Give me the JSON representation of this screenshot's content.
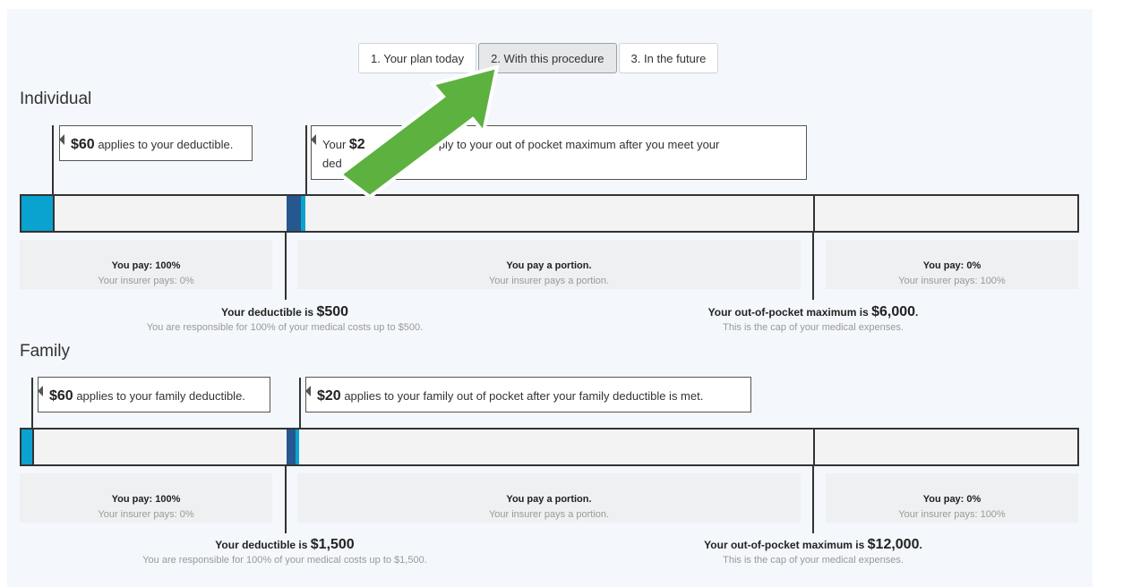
{
  "tabs": [
    {
      "label": "1. Your plan today"
    },
    {
      "label": "2. With this procedure",
      "active": true
    },
    {
      "label": "3. In the future"
    }
  ],
  "colors": {
    "accent_teal": "#0aa2cf",
    "accent_navy": "#26588f",
    "arrow_green": "#5cb13f"
  },
  "individual": {
    "title": "Individual",
    "callout_deductible": {
      "amount": "$60",
      "text": " applies to your deductible."
    },
    "callout_oop": {
      "amount": "$2",
      "text": "apply to your out of pocket maximum after you meet your",
      "text2": "ded"
    },
    "zones": {
      "left": {
        "you_pay": "You pay: 100%",
        "insurer_pays": "Your insurer pays: 0%"
      },
      "mid": {
        "you_pay": "You pay a portion.",
        "insurer_pays": "Your insurer pays a portion."
      },
      "right": {
        "you_pay": "You pay: 0%",
        "insurer_pays": "Your insurer pays: 100%"
      }
    },
    "deductible": {
      "prefix": "Your deductible is ",
      "amount": "$500",
      "sub": "You are responsible for 100% of your medical costs up to $500."
    },
    "oop": {
      "prefix": "Your out-of-pocket maximum is ",
      "amount": "$6,000",
      "suffix": ".",
      "sub": "This is the cap of your medical expenses."
    }
  },
  "family": {
    "title": "Family",
    "callout_deductible": {
      "amount": "$60",
      "text": " applies to your family deductible."
    },
    "callout_oop": {
      "amount": "$20",
      "text": " applies to your family out of pocket after your family deductible is met."
    },
    "zones": {
      "left": {
        "you_pay": "You pay: 100%",
        "insurer_pays": "Your insurer pays: 0%"
      },
      "mid": {
        "you_pay": "You pay a portion.",
        "insurer_pays": "Your insurer pays a portion."
      },
      "right": {
        "you_pay": "You pay: 0%",
        "insurer_pays": "Your insurer pays: 100%"
      }
    },
    "deductible": {
      "prefix": "Your deductible is ",
      "amount": "$1,500",
      "sub": "You are responsible for 100% of your medical costs up to $1,500."
    },
    "oop": {
      "prefix": "Your out-of-pocket maximum is ",
      "amount": "$12,000",
      "suffix": ".",
      "sub": "This is the cap of your medical expenses."
    }
  }
}
